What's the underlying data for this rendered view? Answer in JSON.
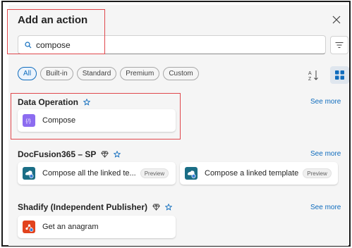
{
  "dialog": {
    "title": "Add an action",
    "search_value": "compose",
    "search_placeholder": "Search"
  },
  "filters": [
    "All",
    "Built-in",
    "Standard",
    "Premium",
    "Custom"
  ],
  "active_filter": "All",
  "sections": [
    {
      "name": "Data Operation",
      "see_more": "See more",
      "cards": [
        {
          "label": "Compose",
          "icon": "compose-icon",
          "color": "#8c6cf0"
        }
      ]
    },
    {
      "name": "DocFusion365 – SP",
      "see_more": "See more",
      "cards": [
        {
          "label": "Compose all the linked te...",
          "badge": "Preview",
          "icon": "docfusion-icon",
          "color": "#1b6e86"
        },
        {
          "label": "Compose a linked template",
          "badge": "Preview",
          "icon": "docfusion-icon",
          "color": "#1b6e86"
        }
      ]
    },
    {
      "name": "Shadify (Independent Publisher)",
      "see_more": "See more",
      "cards": [
        {
          "label": "Get an anagram",
          "icon": "shadify-icon",
          "color": "#e2431d"
        }
      ]
    }
  ],
  "colors": {
    "accent": "#0f6cbd",
    "highlight_box": "#e0474c"
  }
}
